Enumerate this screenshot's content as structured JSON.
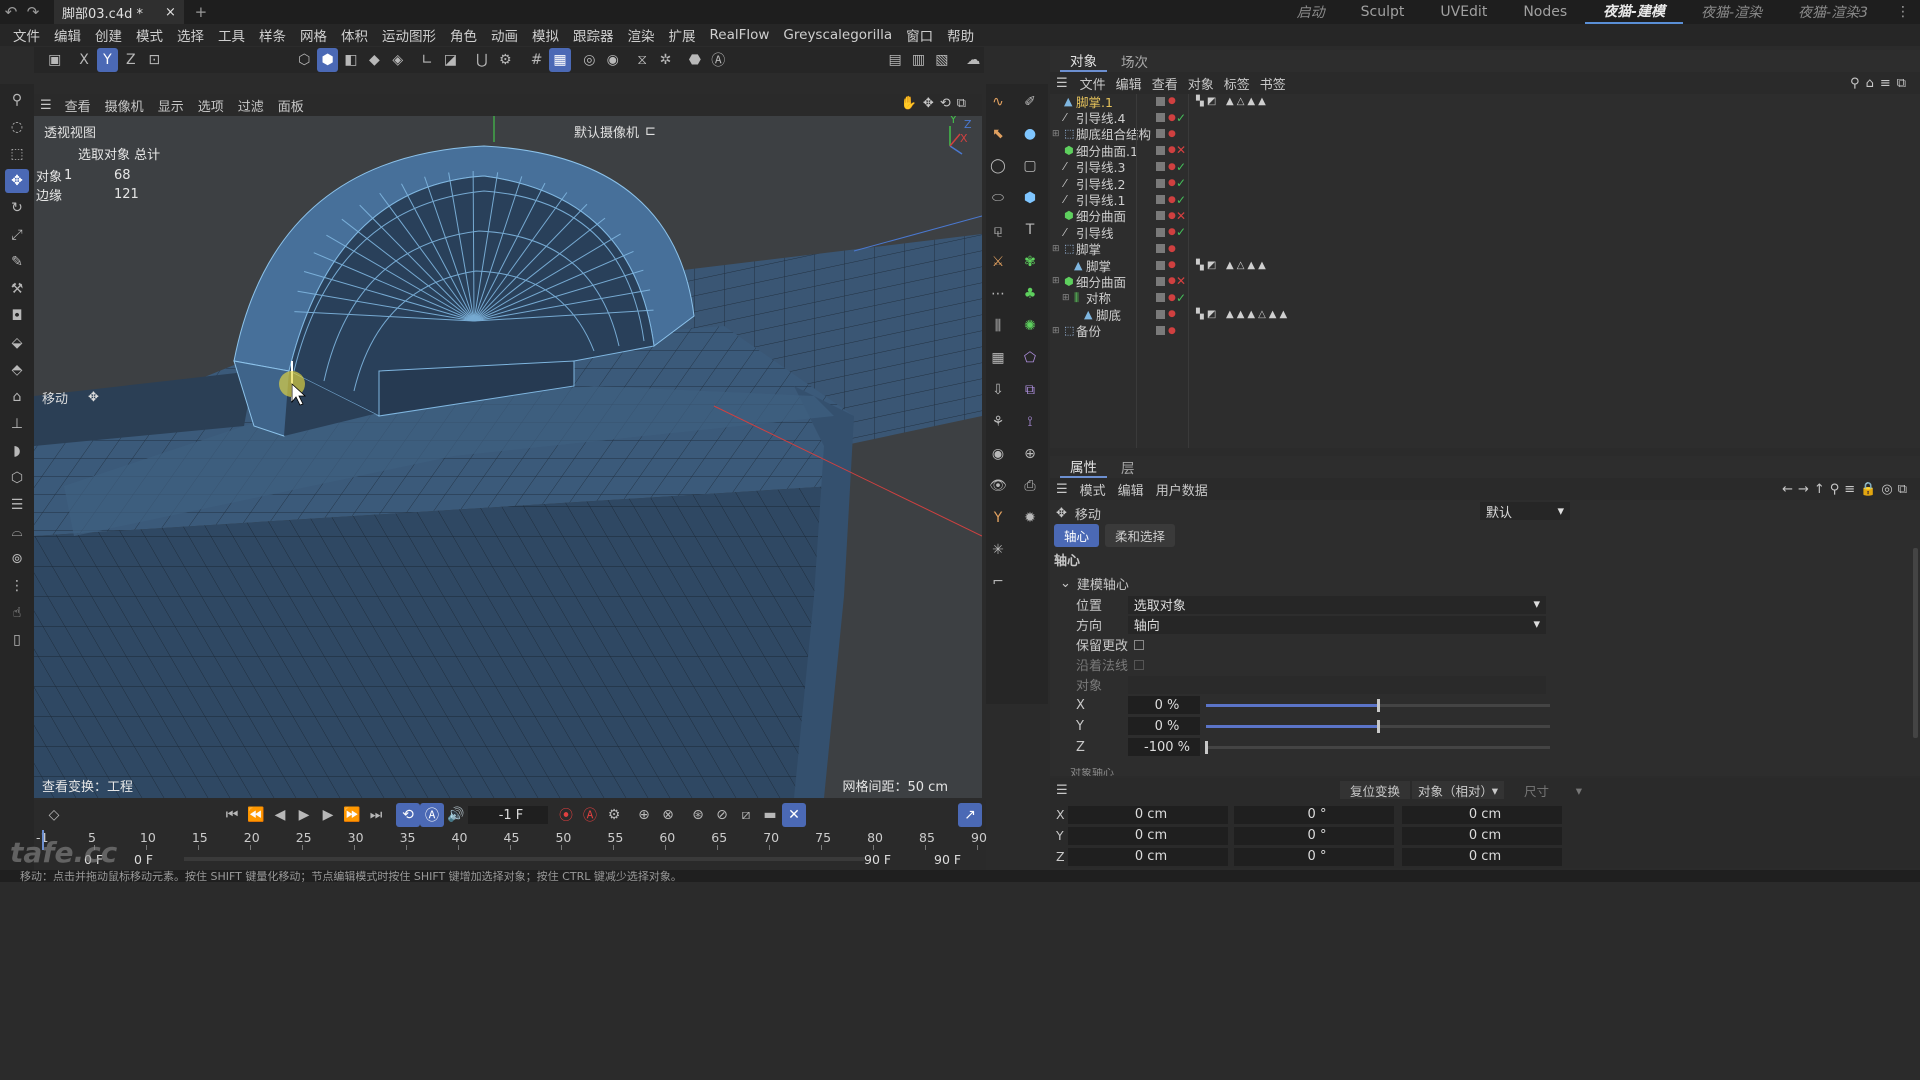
{
  "titlebar": {
    "doc_tab": "脚部03.c4d *",
    "close": "×",
    "add": "+",
    "layouts": [
      {
        "label": "启动",
        "style": "italic"
      },
      {
        "label": "Sculpt",
        "style": "normal"
      },
      {
        "label": "UVEdit",
        "style": "normal"
      },
      {
        "label": "Nodes",
        "style": "normal"
      },
      {
        "label": "夜猫-建模",
        "style": "active"
      },
      {
        "label": "夜猫-渲染",
        "style": "italic"
      },
      {
        "label": "夜猫-渲染3",
        "style": "italic"
      }
    ]
  },
  "menubar": [
    "文件",
    "编辑",
    "创建",
    "模式",
    "选择",
    "工具",
    "样条",
    "网格",
    "体积",
    "运动图形",
    "角色",
    "动画",
    "模拟",
    "跟踪器",
    "渲染",
    "扩展",
    "RealFlow",
    "Greyscalegorilla",
    "窗口",
    "帮助"
  ],
  "toolbar": {
    "axis_x": "X",
    "axis_y": "Y",
    "axis_z": "Z"
  },
  "viewport": {
    "menu": [
      "查看",
      "摄像机",
      "显示",
      "选项",
      "过滤",
      "面板"
    ],
    "name": "透视视图",
    "camera": "默认摄像机",
    "stats": {
      "header": "选取对象 总计",
      "rows": [
        {
          "label": "对象",
          "sel": "1",
          "total": "68"
        },
        {
          "label": "边缘",
          "sel": "",
          "total": "121"
        }
      ]
    },
    "tool_label": "移动",
    "view_transform": "查看变换：工程",
    "grid_spacing": "网格间距：50 cm",
    "axis_labels": {
      "x": "X",
      "y": "Y",
      "z": "Z"
    }
  },
  "object_panel": {
    "tabs": [
      "对象",
      "场次"
    ],
    "menu": [
      "文件",
      "编辑",
      "查看",
      "对象",
      "标签",
      "书签"
    ],
    "items": [
      {
        "name": "脚掌.1",
        "indent": 0,
        "icon": "polygon-icon",
        "state": "none",
        "tags": "▲△▲▲",
        "selected": true
      },
      {
        "name": "引导线.4",
        "indent": 0,
        "icon": "spline-icon",
        "state": "check",
        "tags": ""
      },
      {
        "name": "脚底组合结构",
        "indent": 0,
        "icon": "null-icon",
        "state": "none",
        "tags": ""
      },
      {
        "name": "细分曲面.1",
        "indent": 0,
        "icon": "subdivision-icon",
        "state": "x",
        "tags": ""
      },
      {
        "name": "引导线.3",
        "indent": 0,
        "icon": "spline-icon",
        "state": "check",
        "tags": ""
      },
      {
        "name": "引导线.2",
        "indent": 0,
        "icon": "spline-icon",
        "state": "check",
        "tags": ""
      },
      {
        "name": "引导线.1",
        "indent": 0,
        "icon": "spline-icon",
        "state": "check",
        "tags": ""
      },
      {
        "name": "细分曲面",
        "indent": 0,
        "icon": "subdivision-icon",
        "state": "x",
        "tags": ""
      },
      {
        "name": "引导线",
        "indent": 0,
        "icon": "spline-icon",
        "state": "check",
        "tags": ""
      },
      {
        "name": "脚掌",
        "indent": 0,
        "icon": "null-icon",
        "state": "none",
        "tags": ""
      },
      {
        "name": "脚掌",
        "indent": 1,
        "icon": "polygon-icon",
        "state": "none",
        "tags": "▲△▲▲"
      },
      {
        "name": "细分曲面",
        "indent": 0,
        "icon": "subdivision-icon",
        "state": "x",
        "tags": ""
      },
      {
        "name": "对称",
        "indent": 1,
        "icon": "symmetry-icon",
        "state": "check",
        "tags": ""
      },
      {
        "name": "脚底",
        "indent": 2,
        "icon": "polygon-icon",
        "state": "none",
        "tags": "▲▲▲△▲▲"
      },
      {
        "name": "备份",
        "indent": 0,
        "icon": "null-icon",
        "state": "none",
        "tags": ""
      }
    ]
  },
  "attributes": {
    "tabs": [
      "属性",
      "层"
    ],
    "menu": [
      "模式",
      "编辑",
      "用户数据"
    ],
    "tool": "移动",
    "preset": "默认",
    "subtabs": [
      "轴心",
      "柔和选择"
    ],
    "section": "轴心",
    "group": "建模轴心",
    "position_label": "位置",
    "position_value": "选取对象",
    "orientation_label": "方向",
    "orientation_value": "轴向",
    "keep_changes": "保留更改",
    "along_normal": "沿着法线",
    "object_label": "对象",
    "axes": [
      {
        "label": "X",
        "value": "0 %",
        "percent": 50
      },
      {
        "label": "Y",
        "value": "0 %",
        "percent": 50
      },
      {
        "label": "Z",
        "value": "-100 %",
        "percent": 0
      }
    ],
    "truncated": "对象轴心"
  },
  "coords": {
    "reset": "复位变换",
    "mode": "对象（相对）",
    "size": "尺寸",
    "rows": [
      {
        "axis": "X",
        "pos": "0 cm",
        "rot": "0 °",
        "size": "0 cm"
      },
      {
        "axis": "Y",
        "pos": "0 cm",
        "rot": "0 °",
        "size": "0 cm"
      },
      {
        "axis": "Z",
        "pos": "0 cm",
        "rot": "0 °",
        "size": "0 cm"
      }
    ]
  },
  "timeline": {
    "frame": "-1 F",
    "ticks": [
      "-1",
      "5",
      "10",
      "15",
      "20",
      "25",
      "30",
      "35",
      "40",
      "45",
      "50",
      "55",
      "60",
      "65",
      "70",
      "75",
      "80",
      "85",
      "90"
    ],
    "start": "0 F",
    "start2": "0 F",
    "end": "90 F",
    "end2": "90 F"
  },
  "status": "移动：点击并拖动鼠标移动元素。按住 SHIFT 键量化移动；节点编辑模式时按住 SHIFT 键增加选择对象；按住 CTRL 键减少选择对象。",
  "watermark": "tafe.cc",
  "colors": {
    "accent": "#4b69b5",
    "mesh": "#3c5f82",
    "mesh_line": "#7fb6e0",
    "selected_object": "#e6c35c"
  }
}
